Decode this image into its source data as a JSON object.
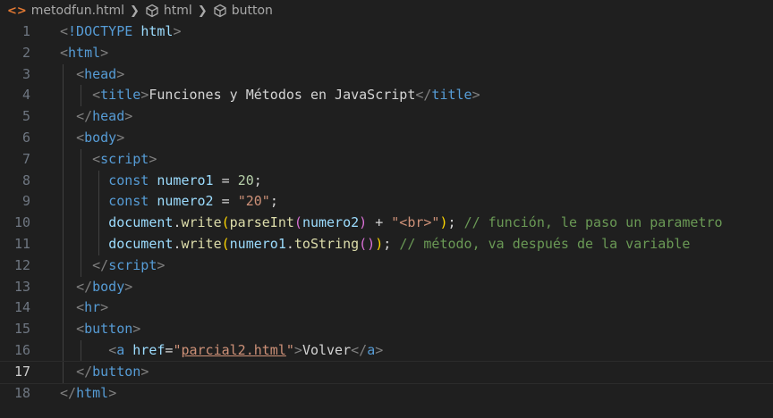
{
  "breadcrumb": {
    "file": "metodfun.html",
    "crumbs": [
      "html",
      "button"
    ],
    "file_icon": "html-file-icon",
    "element_icon": "symbol-element-icon"
  },
  "editor": {
    "active_line": 17,
    "lines": [
      {
        "n": "1",
        "tokens": [
          [
            "t-punct",
            "<"
          ],
          [
            "t-tag",
            "!DOCTYPE "
          ],
          [
            "t-attr",
            "html"
          ],
          [
            "t-punct",
            ">"
          ]
        ]
      },
      {
        "n": "2",
        "tokens": [
          [
            "t-punct",
            "<"
          ],
          [
            "t-tag",
            "html"
          ],
          [
            "t-punct",
            ">"
          ]
        ]
      },
      {
        "n": "3",
        "tokens": [
          [
            "t-text",
            "  "
          ],
          [
            "t-punct",
            "<"
          ],
          [
            "t-tag",
            "head"
          ],
          [
            "t-punct",
            ">"
          ]
        ]
      },
      {
        "n": "4",
        "tokens": [
          [
            "t-text",
            "    "
          ],
          [
            "t-punct",
            "<"
          ],
          [
            "t-tag",
            "title"
          ],
          [
            "t-punct",
            ">"
          ],
          [
            "t-text",
            "Funciones y Métodos en JavaScript"
          ],
          [
            "t-punct",
            "</"
          ],
          [
            "t-tag",
            "title"
          ],
          [
            "t-punct",
            ">"
          ]
        ]
      },
      {
        "n": "5",
        "tokens": [
          [
            "t-text",
            "  "
          ],
          [
            "t-punct",
            "</"
          ],
          [
            "t-tag",
            "head"
          ],
          [
            "t-punct",
            ">"
          ]
        ]
      },
      {
        "n": "6",
        "tokens": [
          [
            "t-text",
            "  "
          ],
          [
            "t-punct",
            "<"
          ],
          [
            "t-tag",
            "body"
          ],
          [
            "t-punct",
            ">"
          ]
        ]
      },
      {
        "n": "7",
        "tokens": [
          [
            "t-text",
            "    "
          ],
          [
            "t-punct",
            "<"
          ],
          [
            "t-tag",
            "script"
          ],
          [
            "t-punct",
            ">"
          ]
        ]
      },
      {
        "n": "8",
        "tokens": [
          [
            "t-text",
            "      "
          ],
          [
            "t-kw",
            "const"
          ],
          [
            "t-text",
            " "
          ],
          [
            "t-var",
            "numero1"
          ],
          [
            "t-op",
            " = "
          ],
          [
            "t-num",
            "20"
          ],
          [
            "t-op",
            ";"
          ]
        ]
      },
      {
        "n": "9",
        "tokens": [
          [
            "t-text",
            "      "
          ],
          [
            "t-kw",
            "const"
          ],
          [
            "t-text",
            " "
          ],
          [
            "t-var",
            "numero2"
          ],
          [
            "t-op",
            " = "
          ],
          [
            "t-str",
            "\"20\""
          ],
          [
            "t-op",
            ";"
          ]
        ]
      },
      {
        "n": "10",
        "tokens": [
          [
            "t-text",
            "      "
          ],
          [
            "t-var",
            "document"
          ],
          [
            "t-op",
            "."
          ],
          [
            "t-fn",
            "write"
          ],
          [
            "t-paren1",
            "("
          ],
          [
            "t-fn",
            "parseInt"
          ],
          [
            "t-paren2",
            "("
          ],
          [
            "t-var",
            "numero2"
          ],
          [
            "t-paren2",
            ")"
          ],
          [
            "t-op",
            " + "
          ],
          [
            "t-str",
            "\"<br>\""
          ],
          [
            "t-paren1",
            ")"
          ],
          [
            "t-op",
            "; "
          ],
          [
            "t-comment",
            "// función, le paso un parametro"
          ]
        ]
      },
      {
        "n": "11",
        "tokens": [
          [
            "t-text",
            "      "
          ],
          [
            "t-var",
            "document"
          ],
          [
            "t-op",
            "."
          ],
          [
            "t-fn",
            "write"
          ],
          [
            "t-paren1",
            "("
          ],
          [
            "t-var",
            "numero1"
          ],
          [
            "t-op",
            "."
          ],
          [
            "t-fn",
            "toString"
          ],
          [
            "t-paren2",
            "()"
          ],
          [
            "t-paren1",
            ")"
          ],
          [
            "t-op",
            "; "
          ],
          [
            "t-comment",
            "// método, va después de la variable"
          ]
        ]
      },
      {
        "n": "12",
        "tokens": [
          [
            "t-text",
            "    "
          ],
          [
            "t-punct",
            "</"
          ],
          [
            "t-tag",
            "script"
          ],
          [
            "t-punct",
            ">"
          ]
        ]
      },
      {
        "n": "13",
        "tokens": [
          [
            "t-text",
            "  "
          ],
          [
            "t-punct",
            "</"
          ],
          [
            "t-tag",
            "body"
          ],
          [
            "t-punct",
            ">"
          ]
        ]
      },
      {
        "n": "14",
        "tokens": [
          [
            "t-text",
            "  "
          ],
          [
            "t-punct",
            "<"
          ],
          [
            "t-tag",
            "hr"
          ],
          [
            "t-punct",
            ">"
          ]
        ]
      },
      {
        "n": "15",
        "tokens": [
          [
            "t-text",
            "  "
          ],
          [
            "t-punct",
            "<"
          ],
          [
            "t-tag",
            "button"
          ],
          [
            "t-punct",
            ">"
          ]
        ]
      },
      {
        "n": "16",
        "tokens": [
          [
            "t-text",
            "      "
          ],
          [
            "t-punct",
            "<"
          ],
          [
            "t-tag",
            "a"
          ],
          [
            "t-text",
            " "
          ],
          [
            "t-attr",
            "href"
          ],
          [
            "t-op",
            "="
          ],
          [
            "t-str",
            "\""
          ],
          [
            "t-link",
            "parcial2.html"
          ],
          [
            "t-str",
            "\""
          ],
          [
            "t-punct",
            ">"
          ],
          [
            "t-text",
            "Volver"
          ],
          [
            "t-punct",
            "</"
          ],
          [
            "t-tag",
            "a"
          ],
          [
            "t-punct",
            ">"
          ]
        ]
      },
      {
        "n": "17",
        "tokens": [
          [
            "t-text",
            "  "
          ],
          [
            "t-punct",
            "</"
          ],
          [
            "t-tag",
            "button"
          ],
          [
            "t-punct",
            ">"
          ]
        ]
      },
      {
        "n": "18",
        "tokens": [
          [
            "t-punct",
            "</"
          ],
          [
            "t-tag",
            "html"
          ],
          [
            "t-punct",
            ">"
          ]
        ]
      }
    ]
  }
}
